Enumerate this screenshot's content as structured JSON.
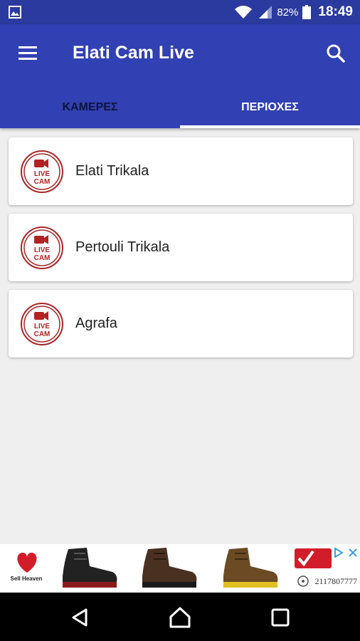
{
  "status_bar": {
    "battery": "82%",
    "time": "18:49",
    "icons": [
      "image-icon",
      "wifi-icon",
      "signal-icon",
      "battery-icon"
    ]
  },
  "app_bar": {
    "title": "Elati Cam Live",
    "menu_icon": "menu-icon",
    "search_icon": "search-icon",
    "color": "#3140b2"
  },
  "tabs": [
    {
      "label": "ΚΑΜΕΡΕΣ",
      "active": false
    },
    {
      "label": "ΠΕΡΙΟΧΕΣ",
      "active": true
    }
  ],
  "locations": [
    {
      "label": "Elati Trikala",
      "icon": "live-cam-icon"
    },
    {
      "label": "Pertouli Trikala",
      "icon": "live-cam-icon"
    },
    {
      "label": "Agrafa",
      "icon": "live-cam-icon"
    }
  ],
  "ad": {
    "phone": "2117807777",
    "icons": [
      "heart-logo-icon",
      "boot-icon",
      "boot-icon",
      "boot-icon",
      "adchoices-icon",
      "close-icon"
    ]
  },
  "nav": {
    "icons": [
      "back-icon",
      "home-icon",
      "recents-icon"
    ]
  },
  "colors": {
    "status_bar": "#2b3a9e",
    "app_bar": "#3140b2",
    "accent_red": "#b22222"
  }
}
